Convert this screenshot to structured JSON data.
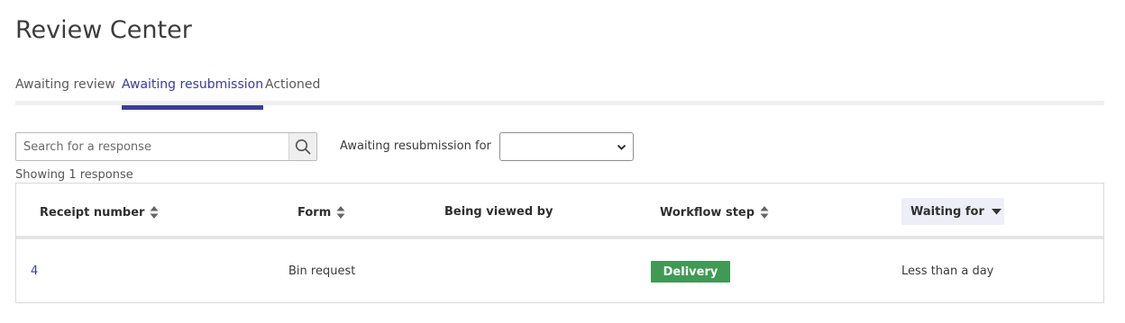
{
  "page": {
    "title": "Review Center"
  },
  "tabs": [
    {
      "label": "Awaiting review",
      "active": false
    },
    {
      "label": "Awaiting resubmission",
      "active": true
    },
    {
      "label": "Actioned",
      "active": false
    }
  ],
  "search": {
    "placeholder": "Search for a response",
    "value": ""
  },
  "filter": {
    "label": "Awaiting resubmission for",
    "selected": ""
  },
  "results": {
    "summary": "Showing 1 response"
  },
  "table": {
    "columns": [
      {
        "label": "Receipt number",
        "sort": "sortable"
      },
      {
        "label": "Form",
        "sort": "sortable"
      },
      {
        "label": "Being viewed by",
        "sort": "none"
      },
      {
        "label": "Workflow step",
        "sort": "sortable"
      },
      {
        "label": "Waiting for",
        "sort": "descending"
      }
    ],
    "rows": [
      {
        "receipt_number": "4",
        "form": "Bin request",
        "being_viewed_by": "",
        "workflow_step": "Delivery",
        "waiting_for": "Less than a day"
      }
    ]
  },
  "colors": {
    "accent": "#3a3aa8",
    "badge_green": "#3f9a53",
    "active_header_bg": "#eeeef8"
  },
  "icons": {
    "search": "magnifier-icon",
    "sort": "sort-updown-icon",
    "sort_desc": "caret-down-icon",
    "select": "chevron-down-icon"
  }
}
